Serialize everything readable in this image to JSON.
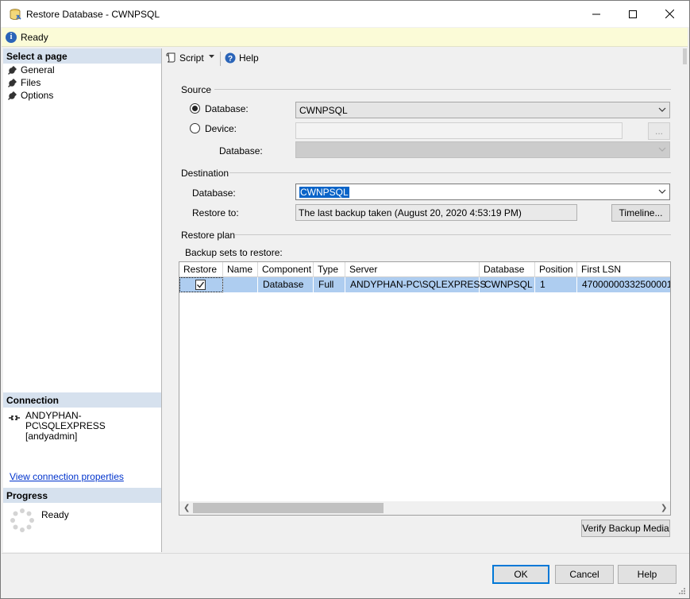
{
  "window": {
    "title": "Restore Database - CWNPSQL"
  },
  "status": {
    "text": "Ready"
  },
  "left_pane": {
    "select_page_header": "Select a page",
    "pages": [
      {
        "label": "General"
      },
      {
        "label": "Files"
      },
      {
        "label": "Options"
      }
    ],
    "connection_header": "Connection",
    "connection_server": "ANDYPHAN-PC\\SQLEXPRESS",
    "connection_user": "[andyadmin]",
    "view_connection_link": "View connection properties",
    "progress_header": "Progress",
    "progress_text": "Ready"
  },
  "toolbar": {
    "script_label": "Script",
    "help_label": "Help"
  },
  "source": {
    "group_label": "Source",
    "database_radio_label": "Database:",
    "database_value": "CWNPSQL",
    "device_radio_label": "Device:",
    "device_value": "",
    "browse_label": "...",
    "device_database_label": "Database:",
    "device_database_value": "",
    "selected": "database"
  },
  "destination": {
    "group_label": "Destination",
    "database_label": "Database:",
    "database_value": "CWNPSQL",
    "restore_to_label": "Restore to:",
    "restore_to_value": "The last backup taken (August 20, 2020 4:53:19 PM)",
    "timeline_label": "Timeline..."
  },
  "restore_plan": {
    "group_label": "Restore plan",
    "backup_sets_label": "Backup sets to restore:",
    "columns": [
      "Restore",
      "Name",
      "Component",
      "Type",
      "Server",
      "Database",
      "Position",
      "First LSN"
    ],
    "rows": [
      {
        "restore": true,
        "name": "",
        "component": "Database",
        "type": "Full",
        "server": "ANDYPHAN-PC\\SQLEXPRESS",
        "database": "CWNPSQL",
        "position": "1",
        "first_lsn": "47000000332500001"
      }
    ],
    "verify_label": "Verify Backup Media"
  },
  "buttons": {
    "ok": "OK",
    "cancel": "Cancel",
    "help": "Help"
  },
  "colors": {
    "section_header_bg": "#d6e1ee",
    "status_bg": "#fbfbd7",
    "selected_row_bg": "#aecdf0",
    "selection_highlight": "#0a64c8",
    "default_button_border": "#0078d7",
    "link": "#0033cc"
  }
}
